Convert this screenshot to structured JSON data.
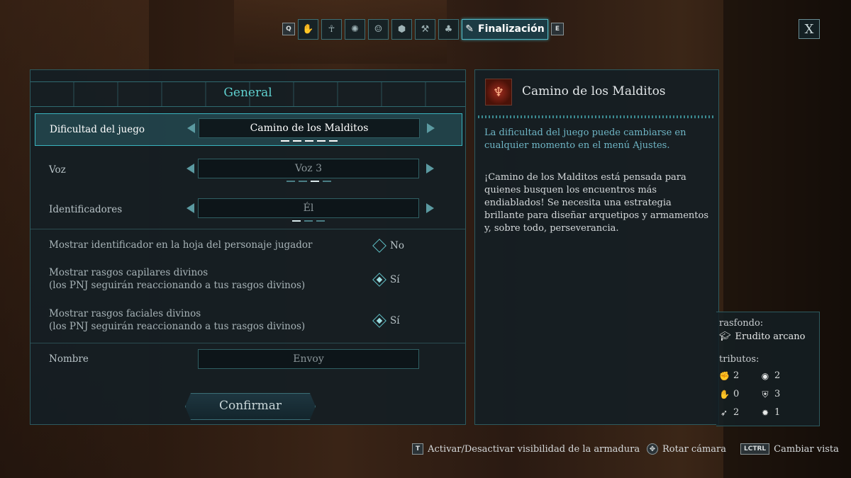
{
  "tabs": {
    "left_key": "Q",
    "right_key": "E",
    "icons": [
      "hand-icon",
      "body-icon",
      "swirl-icon",
      "mask-icon",
      "shield-icon",
      "tools-icon",
      "hair-icon"
    ],
    "active_label": "Finalización",
    "active_icon": "quill-icon",
    "close_label": "X"
  },
  "left_panel": {
    "title": "General",
    "difficulty": {
      "label": "Dificultad del juego",
      "value": "Camino de los Malditos",
      "pips_total": 5,
      "pips_selected": 5
    },
    "voice": {
      "label": "Voz",
      "value": "Voz 3",
      "pips_total": 4,
      "pips_selected": 3
    },
    "identifiers": {
      "label": "Identificadores",
      "value": "Él",
      "pips_total": 3,
      "pips_selected": 1
    },
    "show_identifier": {
      "label": "Mostrar identificador en la hoja del personaje jugador",
      "value": "No"
    },
    "show_hair": {
      "label_line1": "Mostrar rasgos capilares divinos",
      "label_line2": "(los PNJ seguirán reaccionando a tus rasgos divinos)",
      "value": "Sí"
    },
    "show_face": {
      "label_line1": "Mostrar rasgos faciales divinos",
      "label_line2": "(los PNJ seguirán reaccionando a tus rasgos divinos)",
      "value": "Sí"
    },
    "name": {
      "label": "Nombre",
      "value": "Envoy"
    },
    "confirm_label": "Confirmar"
  },
  "right_panel": {
    "title": "Camino de los Malditos",
    "note": "La dificultad del juego puede cambiarse en cualquier momento en el menú Ajustes.",
    "description": "¡Camino de los Malditos está pensada para quienes busquen los encuentros más endiablados! Se necesita una estrategia brillante para diseñar arquetipos y armamentos y, sobre todo, perseverancia."
  },
  "summary": {
    "background_label": "rasfondo:",
    "background_value": "Erudito arcano",
    "attributes_label": "tributos:",
    "attributes": [
      {
        "icon": "strength-icon",
        "value": "2"
      },
      {
        "icon": "perception-icon",
        "value": "2"
      },
      {
        "icon": "dexterity-icon",
        "value": "0"
      },
      {
        "icon": "resolve-icon",
        "value": "3"
      },
      {
        "icon": "agility-icon",
        "value": "2"
      },
      {
        "icon": "mind-icon",
        "value": "1"
      }
    ]
  },
  "hints": [
    {
      "key": "T",
      "label": "Activar/Desactivar visibilidad de la armadura"
    },
    {
      "key": "",
      "label": "Rotar cámara"
    },
    {
      "key": "LCTRL",
      "label": "Cambiar vista"
    }
  ],
  "colors": {
    "accent": "#5fd0cf",
    "panel": "#14232a",
    "border": "#2d5a5f"
  }
}
